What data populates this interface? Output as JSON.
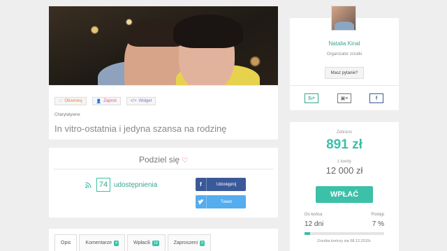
{
  "campaign": {
    "category": "Charytatywne",
    "title": "In vitro-ostatnia i jedyna szansa na rodzinę",
    "actions": [
      {
        "label": "Obserwuj",
        "icon": "heart-outline-icon"
      },
      {
        "label": "Zaproś",
        "icon": "add-user-icon"
      },
      {
        "label": "Widget",
        "icon": "code-icon"
      }
    ]
  },
  "share": {
    "title": "Podziel się",
    "count": "74",
    "count_label": "udostępnienia",
    "facebook_label": "Udostępnij",
    "twitter_label": "Tweet"
  },
  "tabs": [
    {
      "label": "Opis",
      "badge": ""
    },
    {
      "label": "Komentarze",
      "badge": "4"
    },
    {
      "label": "Wpłacili",
      "badge": "19"
    },
    {
      "label": "Zaproszeni",
      "badge": "0"
    }
  ],
  "organizer": {
    "name": "Natalia Kinal",
    "role": "Organizator zrzutki",
    "ask_label": "Masz pytanie?",
    "icons": [
      "money-transfer-icon",
      "id-card-icon",
      "facebook-icon"
    ]
  },
  "donation": {
    "raised_label": "Zebrano",
    "raised": "891 zł",
    "goal_label": "z kwoty",
    "goal": "12 000 zł",
    "pay_label": "WPŁAĆ",
    "days_label": "Do końca",
    "days_value": "12 dni",
    "progress_label": "Postęp",
    "progress_value": "7 %",
    "progress_fraction": 0.07,
    "ends_text": "Zrzutka kończy się 08.12.2015r."
  },
  "colors": {
    "accent": "#3cc0a8",
    "facebook": "#3b5998",
    "twitter": "#55acee"
  }
}
